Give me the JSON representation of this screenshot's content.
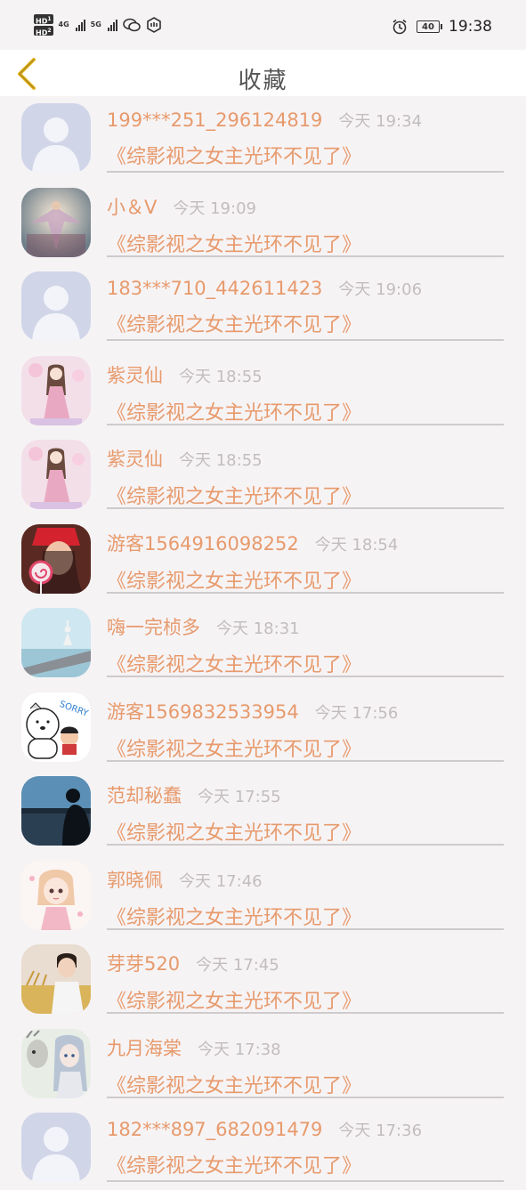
{
  "status_bar": {
    "hd1": "HD",
    "hd1_sub": "1",
    "hd2": "HD",
    "hd2_sub": "2",
    "net1": "4G",
    "net2": "5G",
    "battery": "40",
    "time": "19:38",
    "icons": [
      "signal-icon",
      "wechat-icon",
      "app-notification-icon",
      "alarm-icon",
      "battery-icon"
    ]
  },
  "header": {
    "title": "收藏",
    "back_icon": "chevron-left-icon"
  },
  "colors": {
    "accent": "#e79a6c",
    "timestamp": "#c2bcbf",
    "back_arrow": "#e6b422"
  },
  "favorites": [
    {
      "user": "199***251_296124819",
      "time": "今天 19:34",
      "book": "《综影视之女主光环不见了》",
      "avatar": "default-avatar"
    },
    {
      "user": "小＆V",
      "time": "今天 19:09",
      "book": "《综影视之女主光环不见了》",
      "avatar": "angel-avatar"
    },
    {
      "user": "183***710_442611423",
      "time": "今天 19:06",
      "book": "《综影视之女主光环不见了》",
      "avatar": "default-avatar"
    },
    {
      "user": "紫灵仙",
      "time": "今天 18:55",
      "book": "《综影视之女主光环不见了》",
      "avatar": "anime-girl-pink-avatar"
    },
    {
      "user": "紫灵仙",
      "time": "今天 18:55",
      "book": "《综影视之女主光环不见了》",
      "avatar": "anime-girl-pink-avatar"
    },
    {
      "user": "游客1564916098252",
      "time": "今天 18:54",
      "book": "《综影视之女主光环不见了》",
      "avatar": "girl-lollipop-avatar"
    },
    {
      "user": "嗨一完桢多",
      "time": "今天 18:31",
      "book": "《综影视之女主光环不见了》",
      "avatar": "yoga-pier-avatar"
    },
    {
      "user": "游客1569832533954",
      "time": "今天 17:56",
      "book": "《综影视之女主光环不见了》",
      "avatar": "bear-sorry-avatar"
    },
    {
      "user": "范却秘蠢",
      "time": "今天 17:55",
      "book": "《综影视之女主光环不见了》",
      "avatar": "silhouette-lake-avatar"
    },
    {
      "user": "郭晓佩",
      "time": "今天 17:46",
      "book": "《综影视之女主光环不见了》",
      "avatar": "cartoon-girl-avatar"
    },
    {
      "user": "芽芽520",
      "time": "今天 17:45",
      "book": "《综影视之女主光环不见了》",
      "avatar": "boy-field-avatar"
    },
    {
      "user": "九月海棠",
      "time": "今天 17:38",
      "book": "《综影视之女主光环不见了》",
      "avatar": "girl-deer-avatar"
    },
    {
      "user": "182***897_682091479",
      "time": "今天 17:36",
      "book": "《综影视之女主光环不见了》",
      "avatar": "default-avatar"
    }
  ]
}
